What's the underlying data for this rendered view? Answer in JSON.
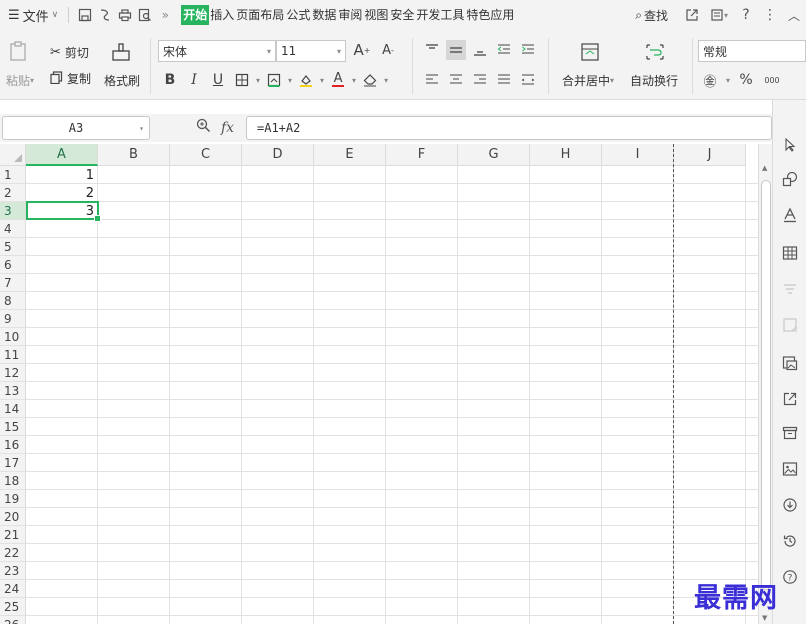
{
  "menubar": {
    "file_label": "文件",
    "tabs": [
      {
        "label": "开始",
        "active": true
      },
      {
        "label": "插入",
        "active": false
      },
      {
        "label": "页面布局",
        "active": false
      },
      {
        "label": "公式",
        "active": false
      },
      {
        "label": "数据",
        "active": false
      },
      {
        "label": "审阅",
        "active": false
      },
      {
        "label": "视图",
        "active": false
      },
      {
        "label": "安全",
        "active": false
      },
      {
        "label": "开发工具",
        "active": false
      },
      {
        "label": "特色应用",
        "active": false
      }
    ],
    "search_label": "查找"
  },
  "ribbon": {
    "paste_label": "粘贴",
    "cut_label": "剪切",
    "copy_label": "复制",
    "format_painter_label": "格式刷",
    "font_name": "宋体",
    "font_size": "11",
    "bold": "B",
    "italic": "I",
    "underline": "U",
    "merge_center_label": "合并居中",
    "wrap_text_label": "自动换行",
    "number_format": "常规",
    "percent": "%",
    "thousands": "000"
  },
  "formula_bar": {
    "name_box": "A3",
    "fx_label": "fx",
    "formula": "=A1+A2"
  },
  "grid": {
    "columns": [
      "A",
      "B",
      "C",
      "D",
      "E",
      "F",
      "G",
      "H",
      "I",
      "J"
    ],
    "active_column": "A",
    "rows": [
      "1",
      "2",
      "3",
      "4",
      "5",
      "6",
      "7",
      "8",
      "9",
      "10",
      "11",
      "12",
      "13",
      "14",
      "15",
      "16",
      "17",
      "18",
      "19",
      "20",
      "21",
      "22",
      "23",
      "24",
      "25",
      "26"
    ],
    "active_row": "3",
    "cells": [
      {
        "ref": "A1",
        "value": "1"
      },
      {
        "ref": "A2",
        "value": "2"
      },
      {
        "ref": "A3",
        "value": "3"
      }
    ],
    "selected_cell": "A3"
  },
  "colors": {
    "accent": "#27b45f",
    "watermark": "#3a2fd6"
  },
  "watermark": "最需网"
}
